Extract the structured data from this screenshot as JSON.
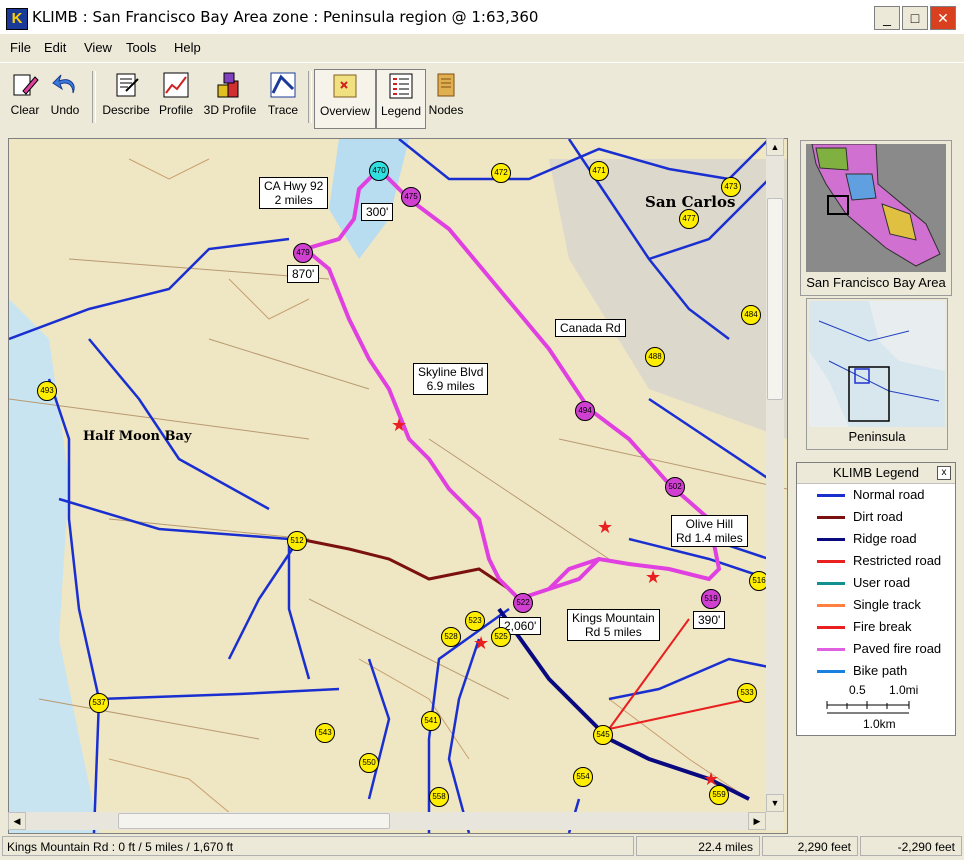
{
  "window": {
    "title": "KLIMB : San Francisco Bay Area zone : Peninsula region @  1:63,360",
    "app_icon": "K",
    "min": "_",
    "max": "□",
    "close": "✕"
  },
  "menu": [
    "File",
    "Edit",
    "View",
    "Tools",
    "Help"
  ],
  "toolbar": {
    "clear": "Clear",
    "undo": "Undo",
    "describe": "Describe",
    "profile": "Profile",
    "profile3d": "3D Profile",
    "trace": "Trace",
    "overview": "Overview",
    "legend": "Legend",
    "nodes": "Nodes"
  },
  "map": {
    "labels": {
      "hwy92": [
        "CA Hwy 92",
        "2 miles"
      ],
      "canada": "Canada Rd",
      "skyline": [
        "Skyline Blvd",
        "6.9 miles"
      ],
      "olive": [
        "Olive Hill",
        "Rd 1.4 miles"
      ],
      "kings": [
        "Kings Mountain",
        "Rd 5 miles"
      ],
      "el300": "300'",
      "el870": "870'",
      "el2060": "2,060'",
      "el390": "390'"
    },
    "places": {
      "hmb": "Half Moon Bay",
      "sancarlos": "San Carlos"
    },
    "nodes": {
      "n470": "470",
      "n475": "475",
      "n472": "472",
      "n471": "471",
      "n473": "473",
      "n477": "477",
      "n479": "479",
      "n484": "484",
      "n488": "488",
      "n493": "493",
      "n494": "494",
      "n502": "502",
      "n512": "512",
      "n516": "516",
      "n519": "519",
      "n522": "522",
      "n523": "523",
      "n525": "525",
      "n528": "528",
      "n533": "533",
      "n537": "537",
      "n541": "541",
      "n543": "543",
      "n545": "545",
      "n550": "550",
      "n554": "554",
      "n558": "558",
      "n559": "559"
    }
  },
  "overview": {
    "zone_caption": "San Francisco Bay Area",
    "region_caption": "Peninsula"
  },
  "legend": {
    "title": "KLIMB Legend",
    "close": "x",
    "items": [
      {
        "label": "Normal road",
        "color": "#1a2fd0"
      },
      {
        "label": "Dirt road",
        "color": "#7a1010"
      },
      {
        "label": "Ridge road",
        "color": "#0a0a80"
      },
      {
        "label": "Restricted road",
        "color": "#e82020"
      },
      {
        "label": "User road",
        "color": "#109090"
      },
      {
        "label": "Single track",
        "color": "#ff8040"
      },
      {
        "label": "Fire break",
        "color": "#e82020"
      },
      {
        "label": "Paved fire road",
        "color": "#e060e0"
      },
      {
        "label": "Bike path",
        "color": "#1880e0"
      }
    ],
    "scale_mi_a": "0.5",
    "scale_mi_b": "1.0mi",
    "scale_km": "1.0km"
  },
  "status": {
    "segment": "Kings Mountain Rd : 0 ft / 5 miles / 1,670 ft",
    "distance": "22.4 miles",
    "elev": "2,290 feet",
    "delta": "-2,290 feet"
  }
}
